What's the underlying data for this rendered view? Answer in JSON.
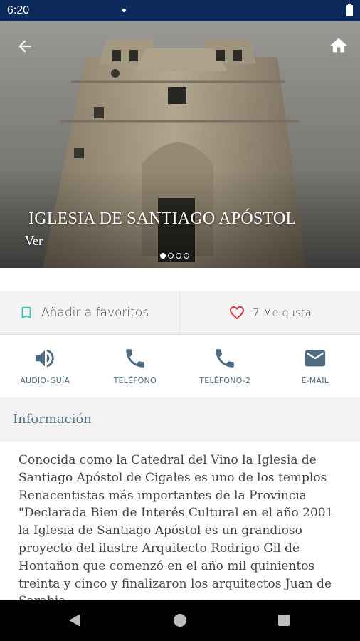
{
  "status_bar": {
    "time": "6:20"
  },
  "hero": {
    "title": "IGLESIA DE SANTIAGO APÓSTOL",
    "subtitle": "Ver",
    "pager_count": 4,
    "pager_active": 0
  },
  "actions": {
    "favorites_label": "Añadir a favoritos",
    "like_label": "7 Me gusta"
  },
  "contacts": [
    {
      "label": "AUDIO-GUÍA",
      "icon": "volume-icon"
    },
    {
      "label": "TELÉFONO",
      "icon": "phone-icon"
    },
    {
      "label": "TELÉFONO-2",
      "icon": "phone-icon"
    },
    {
      "label": "E-MAIL",
      "icon": "mail-icon"
    }
  ],
  "info": {
    "title": "Información",
    "text": "Conocida como la Catedral del Vino la Iglesia de\nSantiago Apóstol de Cigales es uno de los templos\nRenacentistas más importantes de la Provincia\n\"Declarada Bien de Interés Cultural  en el año  2001\nla  Iglesia de Santiago Apóstol es un grandioso\nproyecto del ilustre Arquitecto Rodrigo Gil de\nHontañon que comenzó en el año mil quinientos\ntreinta y cinco y finalizaron los arquitectos Juan de\nSarabia"
  },
  "colors": {
    "status_bar": "#0d2a5c",
    "accent_teal": "#3cc0b4",
    "heart_red": "#d9363e",
    "icon_blue": "#4d6b82"
  }
}
